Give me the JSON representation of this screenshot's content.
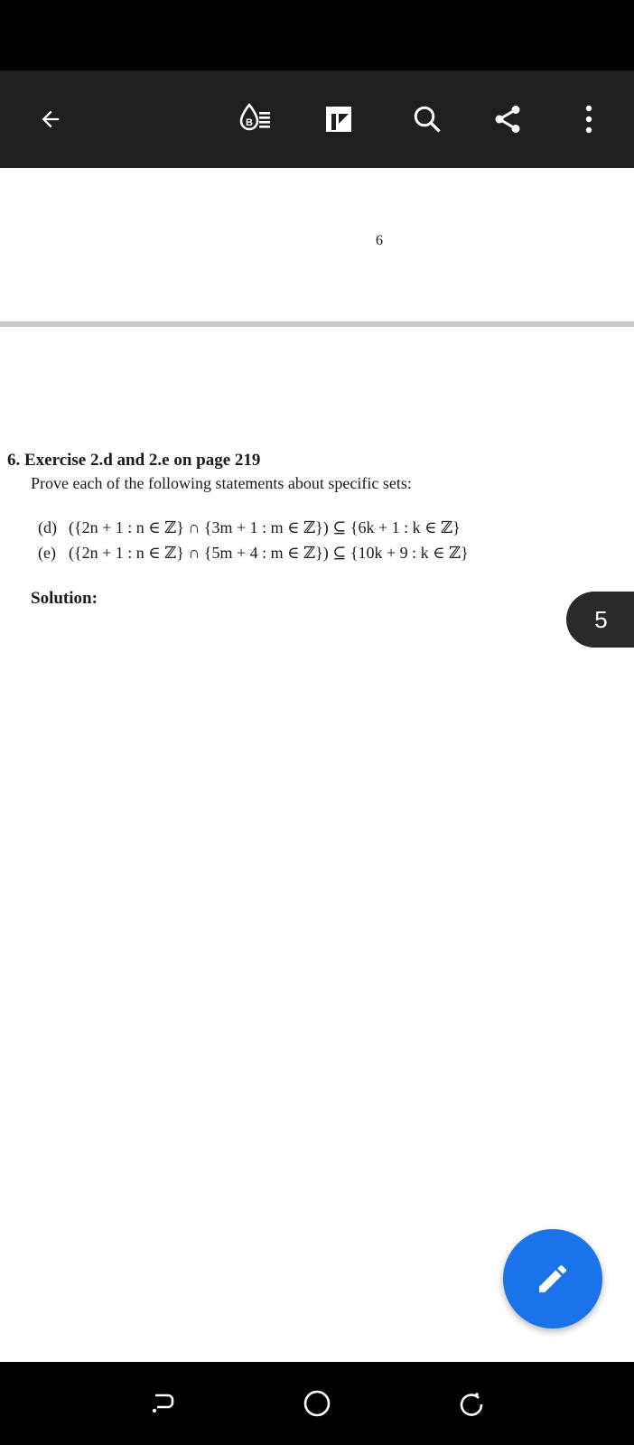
{
  "toolbar": {
    "back_icon": "arrow-back-icon",
    "reading_mode_icon": "reading-mode-icon",
    "annotation_icon": "annotation-icon",
    "search_icon": "search-icon",
    "share_icon": "share-icon",
    "more_icon": "more-vertical-icon"
  },
  "previous_page": {
    "page_number": "6"
  },
  "document": {
    "heading": "6. Exercise 2.d and 2.e on page 219",
    "intro": "Prove each of the following statements about specific sets:",
    "statements": [
      {
        "tag": "(d)",
        "text": "({2n + 1 : n ∈ ℤ} ∩ {3m + 1 : m ∈ ℤ}) ⊆ {6k + 1 : k ∈ ℤ}"
      },
      {
        "tag": "(e)",
        "text": "({2n + 1 : n ∈ ℤ} ∩ {5m + 4 : m ∈ ℤ}) ⊆ {10k + 9 : k ∈ ℤ}"
      }
    ],
    "solution_label": "Solution:"
  },
  "page_indicator": "5",
  "fab": {
    "icon": "edit-pencil-icon"
  },
  "colors": {
    "toolbar_bg": "#1f1f1f",
    "fab_bg": "#1a73e8",
    "badge_bg": "#2a2a2a"
  },
  "nav": {
    "back_icon": "nav-back-icon",
    "home_icon": "nav-home-icon",
    "recents_icon": "nav-recents-icon"
  }
}
